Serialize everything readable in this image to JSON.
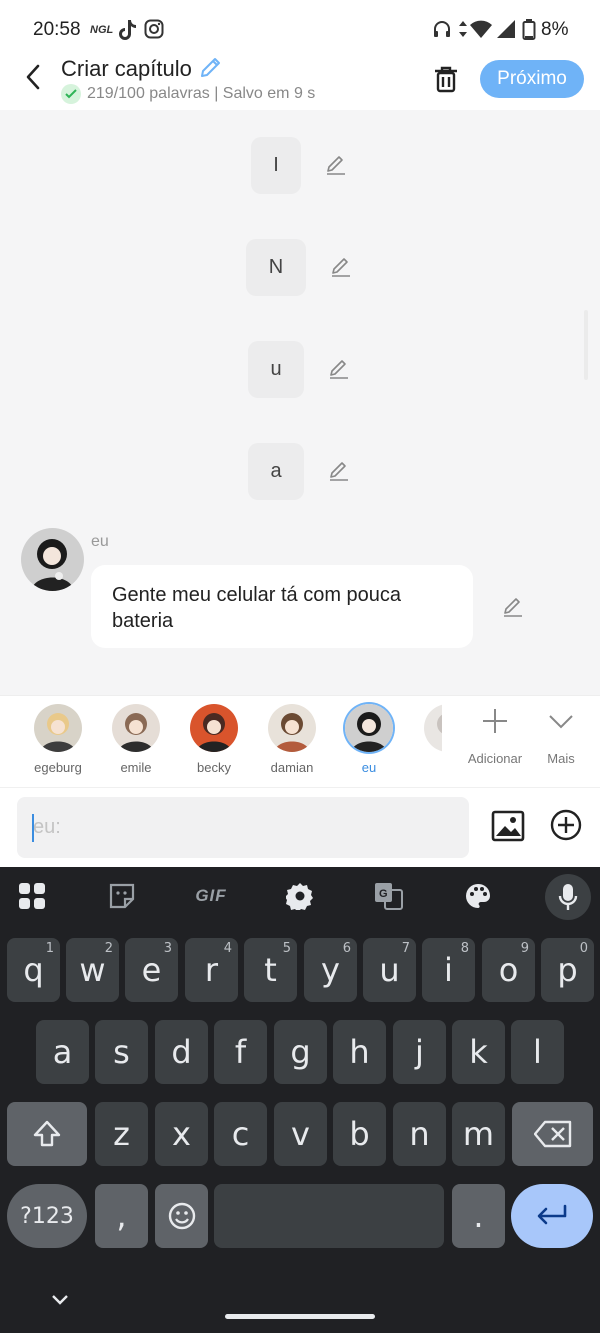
{
  "status": {
    "time": "20:58",
    "ngl_badge": "NGL",
    "battery": "8%"
  },
  "header": {
    "title": "Criar capítulo",
    "subtitle": "219/100 palavras | Salvo em 9 s",
    "next_label": "Próximo"
  },
  "story": {
    "letters": [
      "I",
      "N",
      "u",
      "a"
    ],
    "message": {
      "author": "eu",
      "text": "Gente meu celular tá com pouca bateria"
    }
  },
  "characters": {
    "items": [
      {
        "name": "egeburg"
      },
      {
        "name": "emile"
      },
      {
        "name": "becky"
      },
      {
        "name": "damian"
      },
      {
        "name": "eu"
      }
    ],
    "add_label": "Adicionar",
    "more_label": "Mais"
  },
  "composer": {
    "placeholder": "eu:"
  },
  "keyboard": {
    "gif_label": "GIF",
    "row1": [
      "q",
      "w",
      "e",
      "r",
      "t",
      "y",
      "u",
      "i",
      "o",
      "p"
    ],
    "row1_hints": [
      "1",
      "2",
      "3",
      "4",
      "5",
      "6",
      "7",
      "8",
      "9",
      "0"
    ],
    "row2": [
      "a",
      "s",
      "d",
      "f",
      "g",
      "h",
      "j",
      "k",
      "l"
    ],
    "row3": [
      "z",
      "x",
      "c",
      "v",
      "b",
      "n",
      "m"
    ],
    "symbols_label": "?123",
    "comma": ",",
    "period": "."
  },
  "colors": {
    "accent": "#6fb3f7",
    "active_name": "#3b8de0",
    "keyboard_bg": "#202124",
    "key_bg": "#3c4043"
  }
}
